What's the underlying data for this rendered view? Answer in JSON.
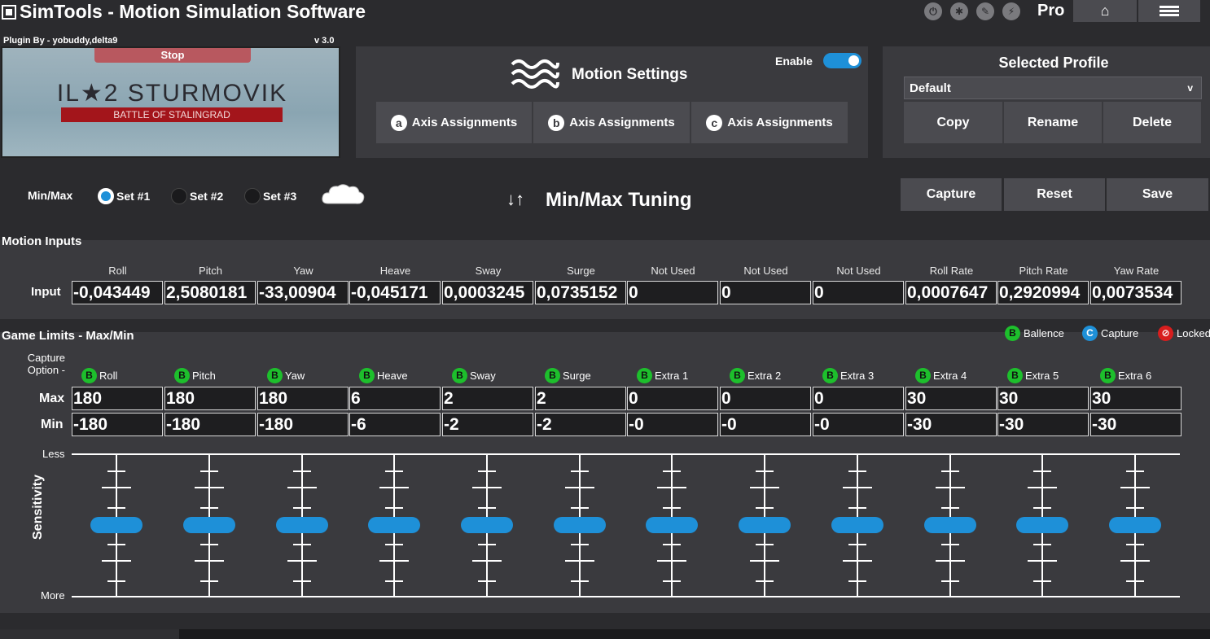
{
  "titlebar": {
    "title": "SimTools - Motion Simulation Software",
    "pro_label": "Pro",
    "icons": [
      "power-icon",
      "settings-gear-icon",
      "edit-icon",
      "plugin-icon"
    ],
    "home_icon": "home-icon",
    "menu_icon": "hamburger-menu-icon"
  },
  "plugin": {
    "author": "Plugin By - yobuddy,delta9",
    "version": "v 3.0",
    "stop_label": "Stop",
    "game_title": "IL★2 STURMOVIK",
    "game_subtitle": "BATTLE OF STALINGRAD"
  },
  "motion_settings": {
    "title": "Motion Settings",
    "enable_label": "Enable",
    "enabled": true,
    "axis_buttons": [
      {
        "letter": "a",
        "label": "Axis Assignments"
      },
      {
        "letter": "b",
        "label": "Axis Assignments"
      },
      {
        "letter": "c",
        "label": "Axis Assignments"
      }
    ]
  },
  "profile": {
    "title": "Selected Profile",
    "selected": "Default",
    "caret": "v",
    "buttons": [
      "Copy",
      "Rename",
      "Delete"
    ]
  },
  "minmax": {
    "label": "Min/Max",
    "sets": [
      "Set #1",
      "Set #2",
      "Set #3"
    ],
    "selected_set": 0,
    "tuning_arrows": "↓↑",
    "tuning_title": "Min/Max Tuning",
    "actions": [
      "Capture",
      "Reset",
      "Save"
    ]
  },
  "motion_inputs": {
    "title": "Motion Inputs",
    "row_label": "Input",
    "columns": [
      "Roll",
      "Pitch",
      "Yaw",
      "Heave",
      "Sway",
      "Surge",
      "Not Used",
      "Not Used",
      "Not Used",
      "Roll Rate",
      "Pitch Rate",
      "Yaw Rate"
    ],
    "values": [
      "-0,043449",
      "2,5080181",
      "-33,00904",
      "-0,045171",
      "0,0003245",
      "0,0735152",
      "0",
      "0",
      "0",
      "0,0007647",
      "0,2920994",
      "0,0073534"
    ]
  },
  "game_limits": {
    "title": "Game Limits - Max/Min",
    "legend": [
      {
        "letter": "B",
        "label": "Ballence",
        "color": "#1dbf2c"
      },
      {
        "letter": "C",
        "label": "Capture",
        "color": "#1e90d8"
      },
      {
        "letter": "⊘",
        "label": "Locked",
        "color": "#d81e1e"
      }
    ],
    "capture_option": "Capture\nOption -",
    "badge_letter": "B",
    "columns": [
      "Roll",
      "Pitch",
      "Yaw",
      "Heave",
      "Sway",
      "Surge",
      "Extra 1",
      "Extra 2",
      "Extra 3",
      "Extra 4",
      "Extra 5",
      "Extra 6"
    ],
    "max_label": "Max",
    "min_label": "Min",
    "max": [
      "180",
      "180",
      "180",
      "6",
      "2",
      "2",
      "0",
      "0",
      "0",
      "30",
      "30",
      "30"
    ],
    "min": [
      "-180",
      "-180",
      "-180",
      "-6",
      "-2",
      "-2",
      "-0",
      "-0",
      "-0",
      "-30",
      "-30",
      "-30"
    ],
    "sensitivity_label": "Sensitivity",
    "less_label": "Less",
    "more_label": "More",
    "sensitivity_levels": [
      0.5,
      0.5,
      0.5,
      0.5,
      0.5,
      0.5,
      0.5,
      0.5,
      0.5,
      0.5,
      0.5,
      0.5
    ]
  },
  "colors": {
    "accent": "#1e90d8",
    "background": "#2b2b2e",
    "panel": "#3a3a3e",
    "button": "#4b4b50",
    "balance_green": "#1dbf2c",
    "locked_red": "#d81e1e"
  }
}
